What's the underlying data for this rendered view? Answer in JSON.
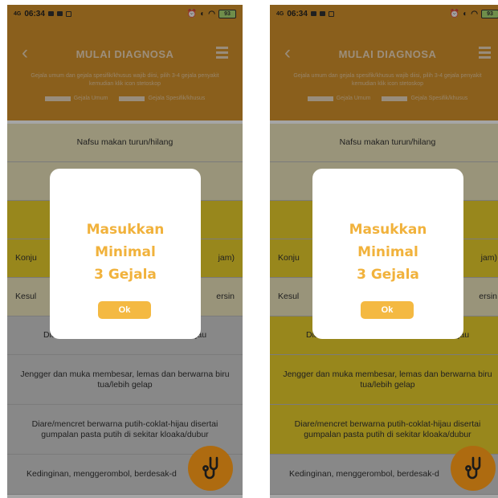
{
  "status_bar": {
    "signal": "4G",
    "time": "06:34",
    "battery": "93"
  },
  "header": {
    "title": "MULAI DIAGNOSA",
    "description": "Gejala umum dan gejala spesifik/khusus wajib diisi, pilih 3-4 gejala penyakit kemudian klik icon stetoskop",
    "legend": [
      {
        "label": "Gejala Umum"
      },
      {
        "label": "Gejala Spesifik/khusus"
      }
    ]
  },
  "screens": [
    {
      "symptoms": [
        {
          "text": "Nafsu makan turun/hilang",
          "tone": "beige"
        },
        {
          "text": "",
          "tone": "beige"
        },
        {
          "text": "",
          "tone": "yellow"
        },
        {
          "text": "Konju",
          "tail": "jam)",
          "tone": "yellow"
        },
        {
          "text": "Kesul",
          "tail": "ersin",
          "tone": "beige"
        },
        {
          "text": "Diare/mencret berwarna kuning-coklat-hijau",
          "tone": "gray"
        },
        {
          "text": "Jengger dan muka membesar, lemas dan berwarna biru tua/lebih gelap",
          "tone": "gray"
        },
        {
          "text": "Diare/mencret berwarna putih-coklat-hijau disertai gumpalan pasta putih di sekitar kloaka/dubur",
          "tone": "gray"
        },
        {
          "text": "Kedinginan, menggerombol, berdesak-d",
          "tone": "gray"
        }
      ]
    },
    {
      "symptoms": [
        {
          "text": "Nafsu makan turun/hilang",
          "tone": "beige"
        },
        {
          "text": "",
          "tone": "beige"
        },
        {
          "text": "",
          "tone": "yellow"
        },
        {
          "text": "Konju",
          "tail": "jam)",
          "tone": "yellow"
        },
        {
          "text": "Kesul",
          "tail": "ersin",
          "tone": "beige"
        },
        {
          "text": "Diare/mencret berwarna kuning-coklat-hijau",
          "tone": "yellow"
        },
        {
          "text": "Jengger dan muka membesar, lemas dan berwarna biru tua/lebih gelap",
          "tone": "yellow"
        },
        {
          "text": "Diare/mencret berwarna putih-coklat-hijau disertai gumpalan pasta putih di sekitar kloaka/dubur",
          "tone": "yellow"
        },
        {
          "text": "Kedinginan, menggerombol, berdesak-d",
          "tone": "gray"
        }
      ]
    }
  ],
  "modal": {
    "line1": "Masukkan",
    "line2": "Minimal",
    "line3": "3 Gejala",
    "ok_label": "Ok"
  },
  "icons": {
    "back": "back-arrow-icon",
    "menu": "hamburger-menu-icon",
    "fab": "stethoscope-icon"
  },
  "colors": {
    "header": "#d38b1b",
    "accent": "#f4b942",
    "fab": "#ae6b10"
  }
}
